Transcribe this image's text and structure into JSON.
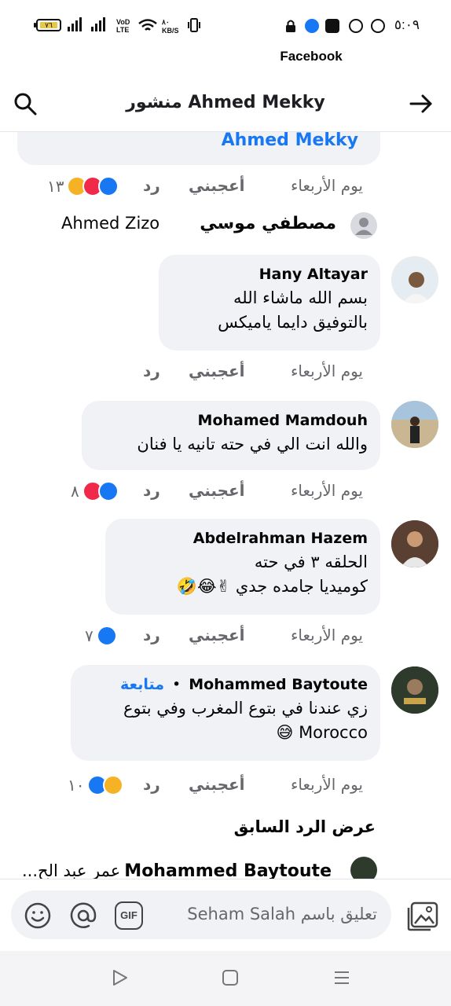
{
  "status_bar": {
    "clock": "٥:٠٩",
    "battery": "٧٦",
    "network_speed_value": "٨٠",
    "network_speed_unit": "KB/S",
    "carrier_tag_1": "VoD",
    "carrier_tag_2": "LTE",
    "app_name": "Facebook"
  },
  "header": {
    "title": "منشور Ahmed Mekky"
  },
  "top_bubble": {
    "link_text": "Ahmed Mekky"
  },
  "first_row": {
    "time": "يوم الأربعاء",
    "like": "أعجبني",
    "reply": "رد",
    "count": "١٣"
  },
  "reply_preview_1": {
    "author": "مصطفي موسي",
    "ellipsis": "...",
    "mention": "Ahmed Zizo"
  },
  "comments": [
    {
      "author": "Hany Altayar",
      "line1": "بسم الله ماشاء الله",
      "line2": "بالتوفيق دايما  ياميكس",
      "time": "يوم الأربعاء",
      "like": "أعجبني",
      "reply": "رد",
      "count": ""
    },
    {
      "author": "Mohamed Mamdouh",
      "line1": "والله انت الي في حته تانيه يا فنان",
      "line2": "",
      "time": "يوم الأربعاء",
      "like": "أعجبني",
      "reply": "رد",
      "count": "٨"
    },
    {
      "author": "Abdelrahman Hazem",
      "line1": "الحلقه ٣ في حته",
      "line2": "كوميديا جامده جدي ✌😂🤣",
      "time": "يوم الأربعاء",
      "like": "أعجبني",
      "reply": "رد",
      "count": "٧"
    },
    {
      "author": "Mohammed Baytoute",
      "follow": "متابعة",
      "dot": "•",
      "line1": "زي عندنا في بتوع المغرب وفي بتوع",
      "line2": "Morocco 😅",
      "time": "يوم الأربعاء",
      "like": "أعجبني",
      "reply": "رد",
      "count": "١٠"
    }
  ],
  "view_previous": "عرض الرد السابق",
  "reply_preview_2": {
    "author": "Mohammed Baytoute",
    "mention": "عمر عبد الح..."
  },
  "composer": {
    "placeholder": "تعليق باسم Seham Salah",
    "gif": "GIF"
  },
  "colors": {
    "facebook_blue": "#1877f2",
    "bubble_bg": "#f0f2f5",
    "secondary_text": "#65676b",
    "love_red": "#f02849",
    "emoji_yellow": "#f7b125"
  }
}
